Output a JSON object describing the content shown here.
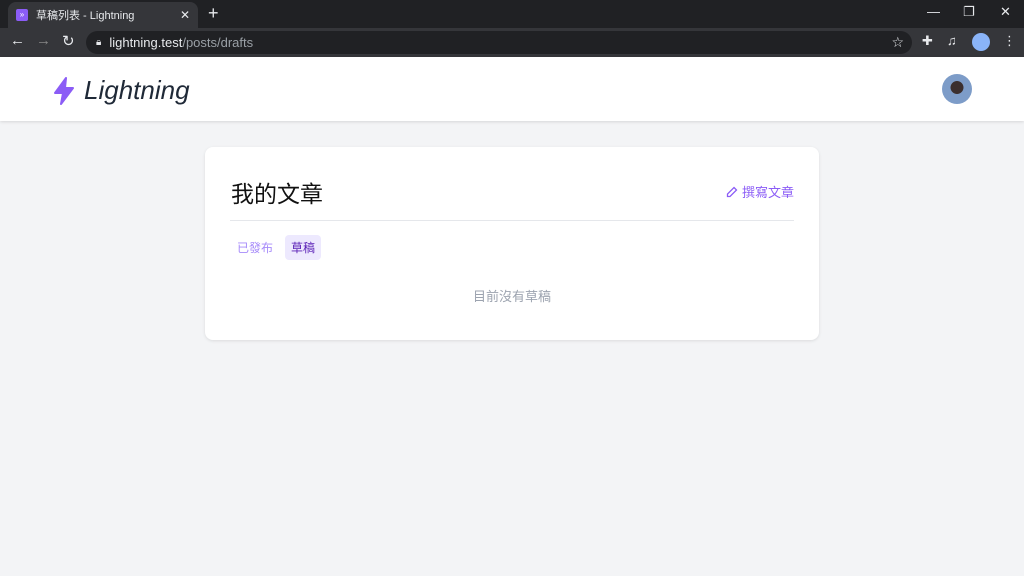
{
  "browser": {
    "tab_title": "草稿列表 - Lightning",
    "url_host": "lightning.test",
    "url_path": "/posts/drafts"
  },
  "header": {
    "brand": "Lightning"
  },
  "card": {
    "title": "我的文章",
    "write_label": "撰寫文章",
    "tabs": [
      {
        "label": "已發布"
      },
      {
        "label": "草稿"
      }
    ],
    "empty_message": "目前沒有草稿"
  },
  "colors": {
    "accent": "#8b5cf6"
  }
}
